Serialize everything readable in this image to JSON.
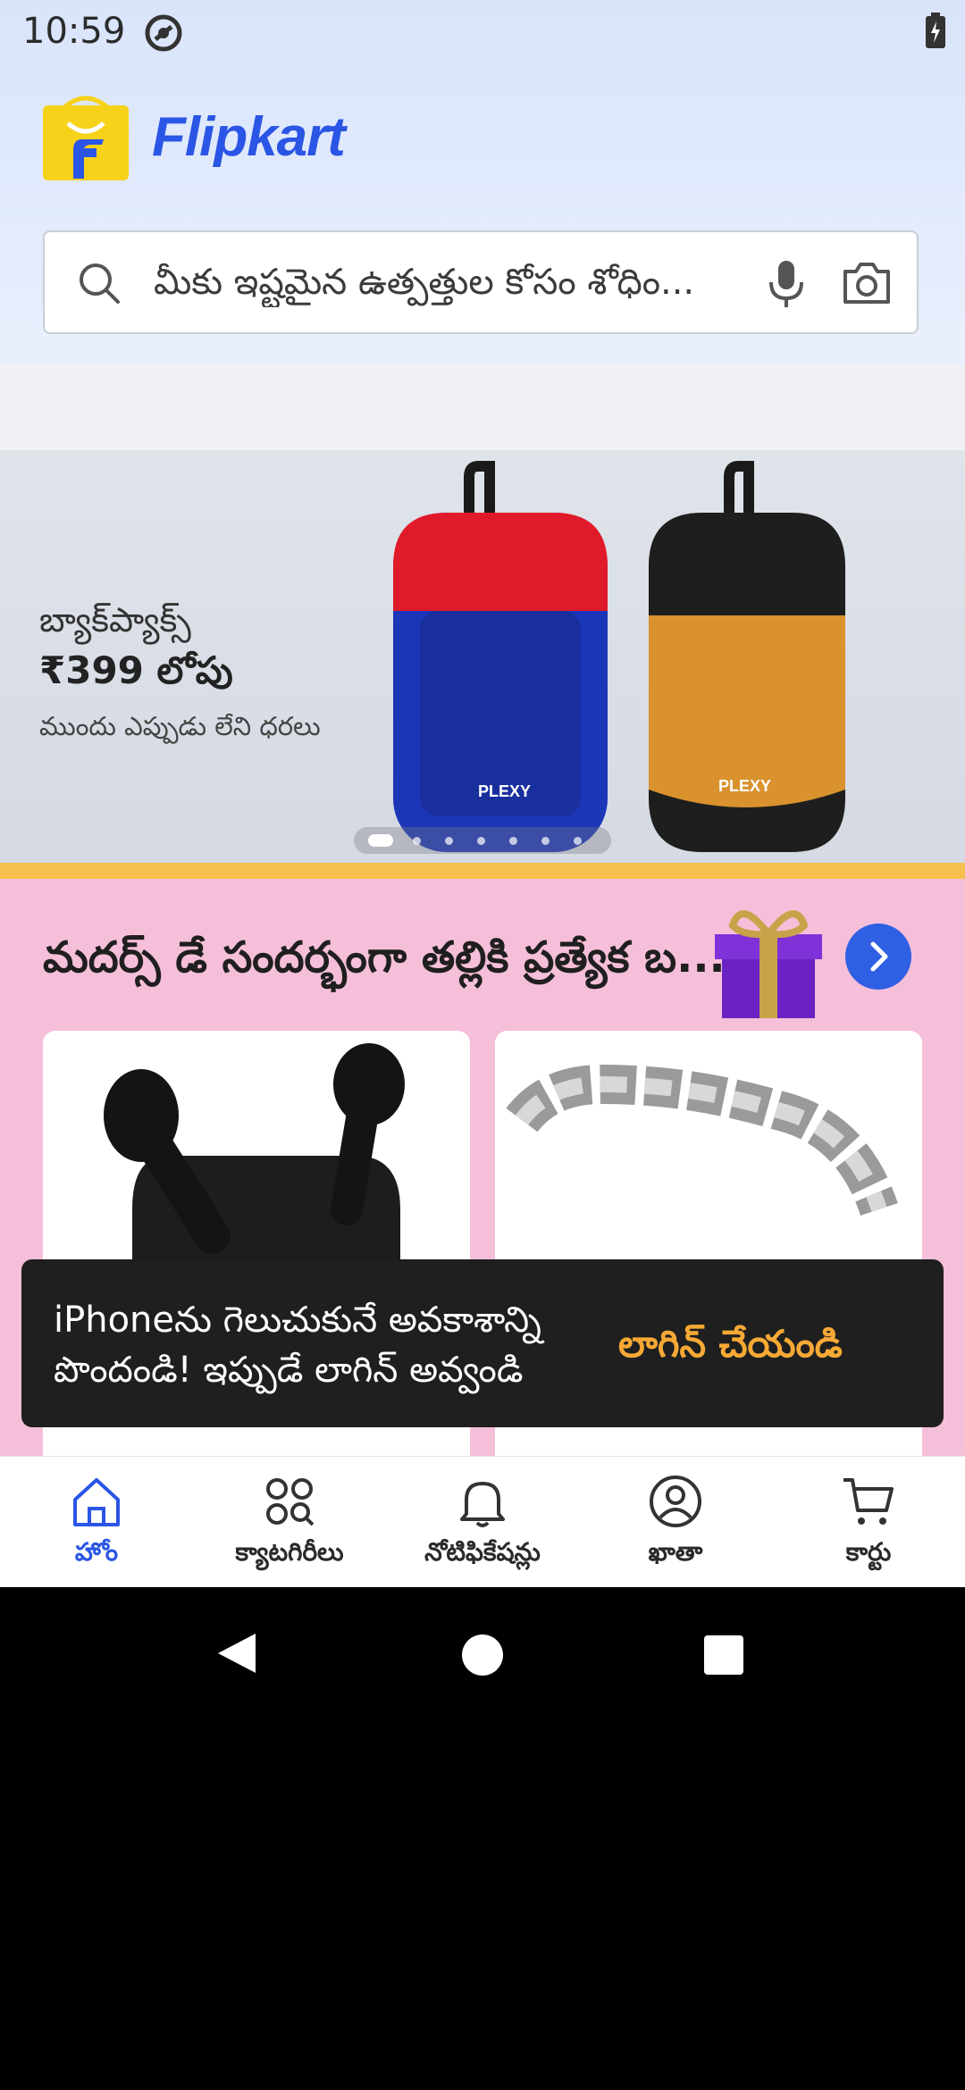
{
  "status_bar": {
    "time": "10:59"
  },
  "header": {
    "brand": "Flipkart"
  },
  "search": {
    "placeholder": "మీకు ఇష్టమైన ఉత్పత్తుల కోసం శోధిం..."
  },
  "banner": {
    "title": "బ్యాక్‌ప్యాక్స్",
    "price": "₹399 లోపు",
    "subtitle": "ముందు ఎప్పుడు లేని ధరలు",
    "bag_brand": "PLEXY",
    "carousel_dots": 7,
    "active_dot": 1
  },
  "promo": {
    "title": "మదర్స్ డే సందర్భంగా తల్లికి ప్రత్యేక బ..."
  },
  "toast": {
    "message": "iPhoneను గెలుచుకునే అవకాశాన్ని పొందండి! ఇప్పుడే లాగిన్ అవ్వండి",
    "action": "లాగిన్ చేయండి"
  },
  "bottom_nav": {
    "items": [
      {
        "label": "హోం",
        "icon": "home-icon",
        "active": true
      },
      {
        "label": "క్యాటగిరీలు",
        "icon": "categories-icon",
        "active": false
      },
      {
        "label": "నోటిఫికేషన్లు",
        "icon": "bell-icon",
        "active": false
      },
      {
        "label": "ఖాతా",
        "icon": "account-icon",
        "active": false
      },
      {
        "label": "కార్టు",
        "icon": "cart-icon",
        "active": false
      }
    ]
  },
  "colors": {
    "brand_blue": "#2a55e5",
    "promo_pink": "#f6bfd9",
    "toast_action": "#f7a935"
  }
}
